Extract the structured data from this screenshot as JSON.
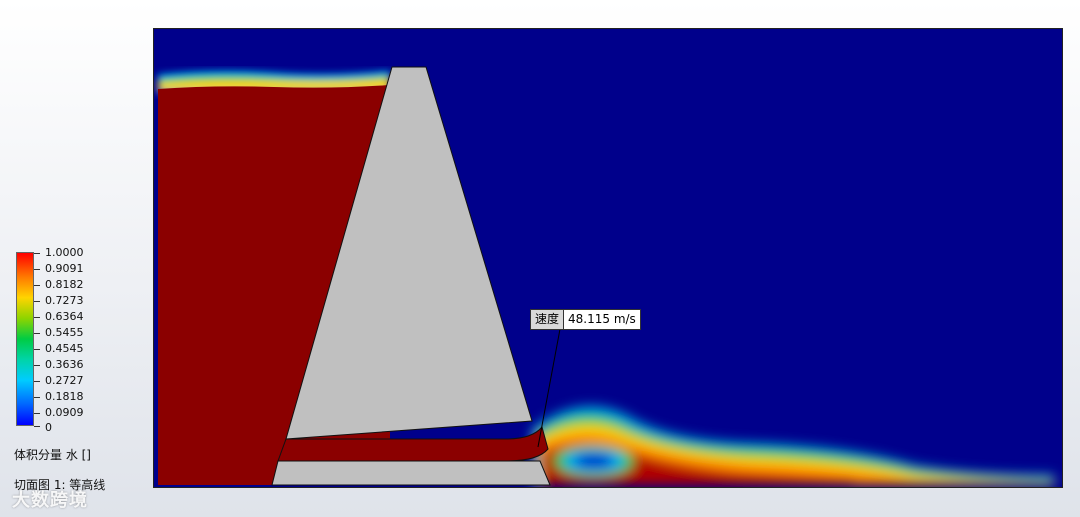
{
  "legend": {
    "ticks": [
      "1.0000",
      "0.9091",
      "0.8182",
      "0.7273",
      "0.6364",
      "0.5455",
      "0.4545",
      "0.3636",
      "0.2727",
      "0.1818",
      "0.0909",
      "0"
    ],
    "title": "体积分量 水 []",
    "colormap": [
      "#ff0000",
      "#ff7a00",
      "#ffd400",
      "#8ed400",
      "#00cc44",
      "#00d4a8",
      "#00ccff",
      "#0066ff",
      "#0000ff"
    ]
  },
  "plot_caption": "切面图 1: 等高线",
  "probe": {
    "label": "速度",
    "value": "48.115 m/s"
  },
  "colors": {
    "water": "#8b0000",
    "air": "#00008b",
    "dam": "#c0c0c0"
  },
  "watermark": "大数跨境"
}
